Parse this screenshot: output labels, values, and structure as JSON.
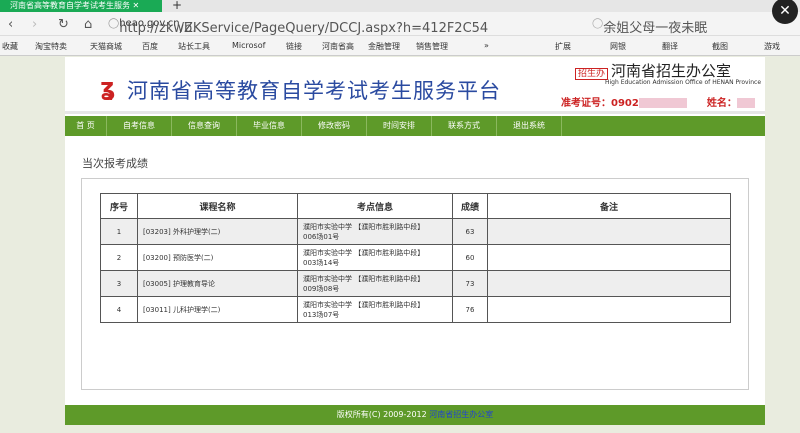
{
  "browser": {
    "tab_title": "河南省高等教育自学考试考生服务",
    "url_prefix": "http://zkwb.",
    "url_domain": "heao.gov.cn",
    "url_path": "/ZKService/PageQuery/DCCJ.aspx?h=412F2C54",
    "search_text": "余姐父母一夜未眠",
    "bookmarks": [
      "收藏",
      "淘宝特卖",
      "天猫商城",
      "百度",
      "站长工具",
      "Microsof",
      "链接",
      "河南省高",
      "金融管理",
      "销售管理",
      "»"
    ],
    "tools": [
      "扩展",
      "网银",
      "翻译",
      "截图",
      "游戏"
    ]
  },
  "header": {
    "title": "河南省高等教育自学考试考生服务平台",
    "org_badge": "招生办",
    "org_name": "河南省招生办公室",
    "org_en": "High Education Admission Office of HENAN Province",
    "ticket_label": "准考证号：0902",
    "name_label": "姓名："
  },
  "nav": [
    "首 页",
    "自考信息",
    "信息查询",
    "毕业信息",
    "修改密码",
    "时间安排",
    "联系方式",
    "退出系统"
  ],
  "section_title": "当次报考成绩",
  "table": {
    "headers": [
      "序号",
      "课程名称",
      "考点信息",
      "成绩",
      "备注"
    ],
    "rows": [
      {
        "no": "1",
        "course": "[03203] 外科护理学(二)",
        "site": "濮阳市实验中学 【濮阳市胜利路中段】",
        "seat": "006场01号",
        "score": "63",
        "note": ""
      },
      {
        "no": "2",
        "course": "[03200] 预防医学(二)",
        "site": "濮阳市实验中学 【濮阳市胜利路中段】",
        "seat": "003场14号",
        "score": "60",
        "note": ""
      },
      {
        "no": "3",
        "course": "[03005] 护理教育导论",
        "site": "濮阳市实验中学 【濮阳市胜利路中段】",
        "seat": "009场08号",
        "score": "73",
        "note": ""
      },
      {
        "no": "4",
        "course": "[03011] 儿科护理学(二)",
        "site": "濮阳市实验中学 【濮阳市胜利路中段】",
        "seat": "013场07号",
        "score": "76",
        "note": ""
      }
    ]
  },
  "footer": {
    "copyright": "版权所有(C) 2009-2012 ",
    "link": "河南省招生办公室"
  }
}
